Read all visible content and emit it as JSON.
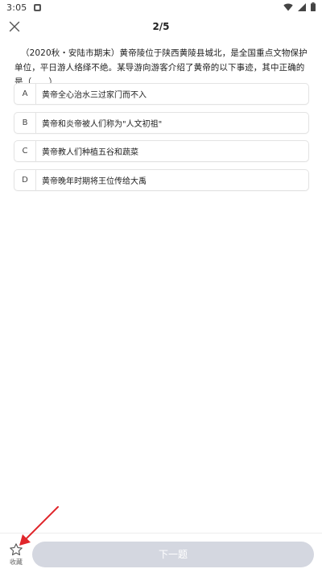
{
  "status_bar": {
    "time": "3:05",
    "icons": [
      "notification-icon",
      "wifi-icon",
      "signal-icon",
      "battery-icon"
    ]
  },
  "header": {
    "close_icon": "close-icon",
    "progress": "2/5"
  },
  "question": {
    "text": "（2020秋・安陆市期末）黄帝陵位于陕西黄陵县城北，是全国重点文物保护单位，平日游人络绎不绝。某导游向游客介绍了黄帝的以下事迹，其中正确的是（　　）"
  },
  "options": [
    {
      "letter": "A",
      "text": "黄帝全心治水三过家门而不入"
    },
    {
      "letter": "B",
      "text": "黄帝和炎帝被人们称为\"人文初祖\""
    },
    {
      "letter": "C",
      "text": "黄帝教人们种植五谷和蔬菜"
    },
    {
      "letter": "D",
      "text": "黄帝晚年时期将王位传给大禹"
    }
  ],
  "bottom_bar": {
    "favorite_label": "收藏",
    "favorite_icon": "star-icon",
    "next_label": "下一题"
  },
  "colors": {
    "next_button_bg": "#d4d7e0",
    "annotation_arrow": "#e0262b",
    "option_border": "#e3e3e3"
  }
}
